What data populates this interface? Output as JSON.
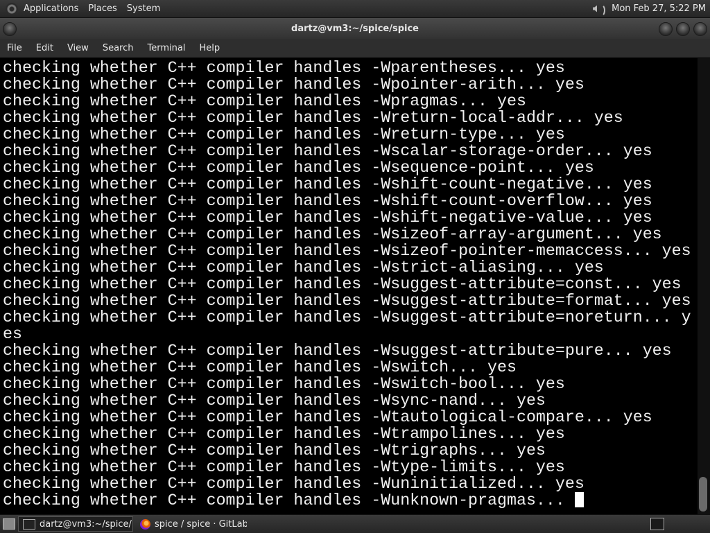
{
  "top_panel": {
    "menus": [
      "Applications",
      "Places",
      "System"
    ],
    "clock": "Mon Feb 27,  5:22 PM"
  },
  "window": {
    "title": "dartz@vm3:~/spice/spice",
    "menu": [
      "File",
      "Edit",
      "View",
      "Search",
      "Terminal",
      "Help"
    ]
  },
  "terminal": {
    "lines": [
      "checking whether C++ compiler handles -Wparentheses... yes",
      "checking whether C++ compiler handles -Wpointer-arith... yes",
      "checking whether C++ compiler handles -Wpragmas... yes",
      "checking whether C++ compiler handles -Wreturn-local-addr... yes",
      "checking whether C++ compiler handles -Wreturn-type... yes",
      "checking whether C++ compiler handles -Wscalar-storage-order... yes",
      "checking whether C++ compiler handles -Wsequence-point... yes",
      "checking whether C++ compiler handles -Wshift-count-negative... yes",
      "checking whether C++ compiler handles -Wshift-count-overflow... yes",
      "checking whether C++ compiler handles -Wshift-negative-value... yes",
      "checking whether C++ compiler handles -Wsizeof-array-argument... yes",
      "checking whether C++ compiler handles -Wsizeof-pointer-memaccess... yes",
      "checking whether C++ compiler handles -Wstrict-aliasing... yes",
      "checking whether C++ compiler handles -Wsuggest-attribute=const... yes",
      "checking whether C++ compiler handles -Wsuggest-attribute=format... yes",
      "checking whether C++ compiler handles -Wsuggest-attribute=noreturn... y",
      "es",
      "checking whether C++ compiler handles -Wsuggest-attribute=pure... yes",
      "checking whether C++ compiler handles -Wswitch... yes",
      "checking whether C++ compiler handles -Wswitch-bool... yes",
      "checking whether C++ compiler handles -Wsync-nand... yes",
      "checking whether C++ compiler handles -Wtautological-compare... yes",
      "checking whether C++ compiler handles -Wtrampolines... yes",
      "checking whether C++ compiler handles -Wtrigraphs... yes",
      "checking whether C++ compiler handles -Wtype-limits... yes",
      "checking whether C++ compiler handles -Wuninitialized... yes",
      "checking whether C++ compiler handles -Wunknown-pragmas... "
    ]
  },
  "taskbar": {
    "tasks": [
      "dartz@vm3:~/spice/...",
      "spice / spice · GitLab..."
    ]
  },
  "icons": {
    "panel_logo": "gnome-foot-icon",
    "volume": "volume-icon",
    "show_desktop": "show-desktop-icon",
    "terminal_task": "terminal-icon",
    "firefox_task": "firefox-icon",
    "tray": "terminal-tray-icon"
  }
}
